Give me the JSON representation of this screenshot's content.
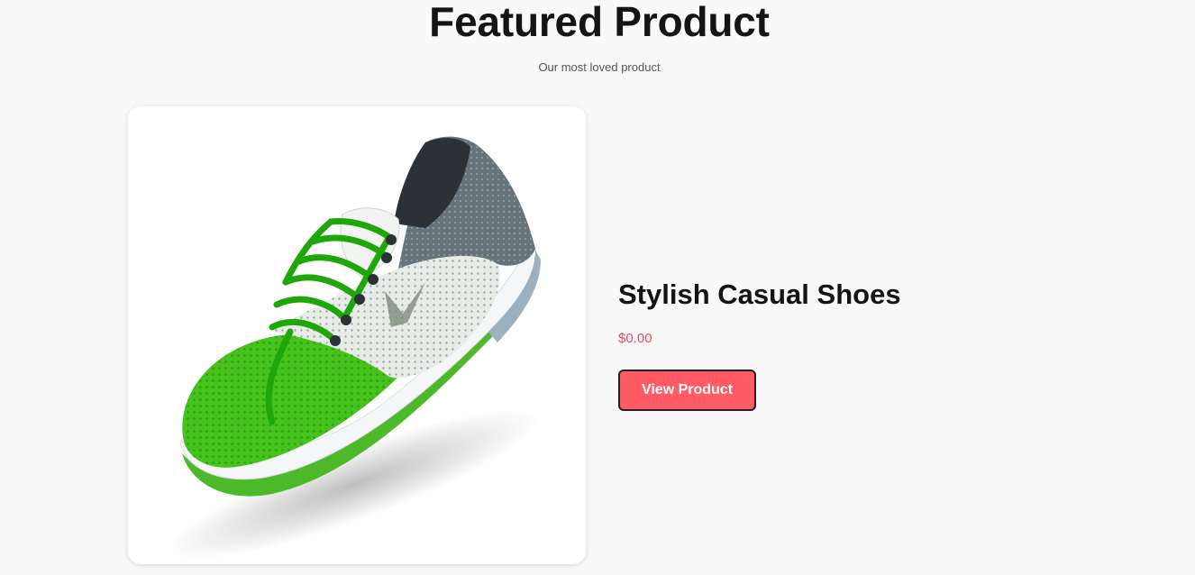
{
  "section": {
    "title": "Featured Product",
    "subtitle": "Our most loved product"
  },
  "product": {
    "name": "Stylish Casual Shoes",
    "price": "$0.00",
    "image_subject": "green-and-grey-running-shoe",
    "button_label": "View Product"
  },
  "colors": {
    "background": "#f9f9f9",
    "price": "#e04e5c",
    "button_bg": "#ff5a66",
    "button_text": "#ffffff",
    "shoe_green": "#3fbf1a",
    "shoe_grey": "#5f6b72"
  }
}
